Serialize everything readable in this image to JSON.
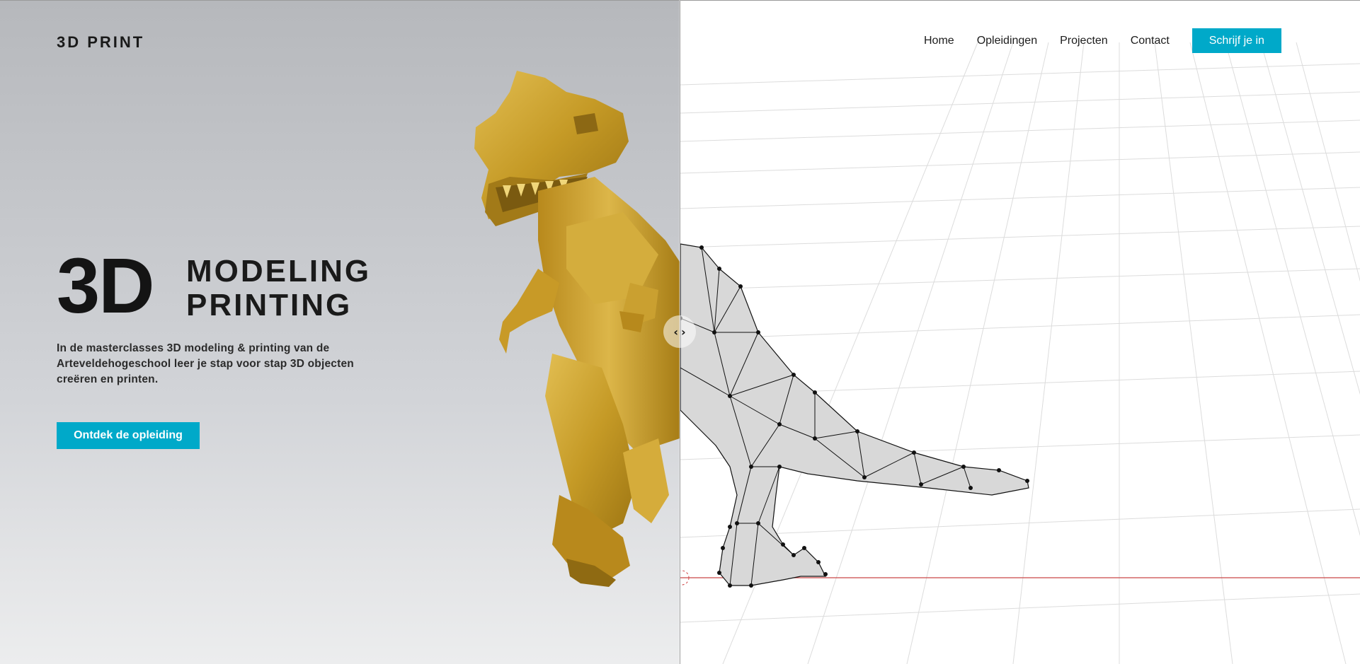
{
  "brand": {
    "label": "3D PRINT"
  },
  "nav": {
    "links": [
      "Home",
      "Opleidingen",
      "Projecten",
      "Contact"
    ],
    "cta_label": "Schrijf je in"
  },
  "hero": {
    "big_label": "3D",
    "line1": "MODELING",
    "line2": "PRINTING",
    "description": "In de masterclasses 3D modeling & printing van de Arteveldehogeschool leer je stap voor stap 3D objecten creëren en printen.",
    "cta_label": "Ontdek de opleiding"
  },
  "slider": {
    "left_arrow": "‹",
    "right_arrow": "›"
  },
  "colors": {
    "accent": "#00a9c9",
    "gold": "#c9a12c",
    "text_dark": "#1a1a1a"
  },
  "icons": {
    "slider_left": "chevron-left-icon",
    "slider_right": "chevron-right-icon"
  }
}
